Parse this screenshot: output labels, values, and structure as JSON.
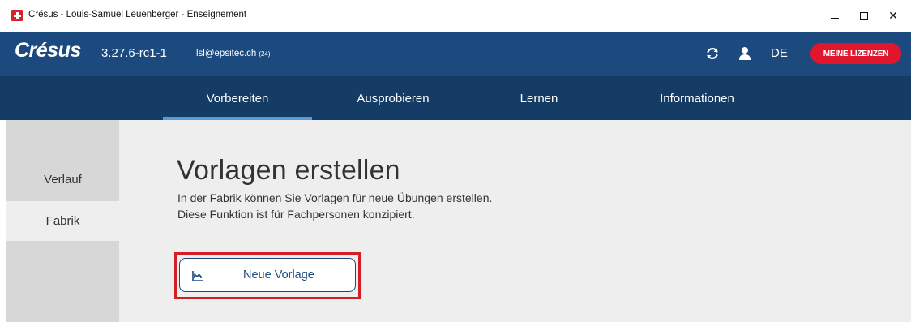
{
  "window": {
    "title": "Crésus - Louis-Samuel Leuenberger - Enseignement",
    "minimize_glyph": "—",
    "close_glyph": "✕"
  },
  "header": {
    "logo": "Crésus",
    "version": "3.27.6-rc1-1",
    "email": "lsl@epsitec.ch",
    "email_count": "(24)",
    "language": "DE",
    "license_button": "MEINE LIZENZEN",
    "icons": [
      "refresh-icon",
      "user-icon"
    ],
    "accent_color": "#1c4a7e",
    "license_color": "#e0172c"
  },
  "nav": {
    "items": [
      {
        "label": "Vorbereiten",
        "active": true
      },
      {
        "label": "Ausprobieren",
        "active": false
      },
      {
        "label": "Lernen",
        "active": false
      },
      {
        "label": "Informationen",
        "active": false
      }
    ]
  },
  "sidebar": {
    "items": [
      {
        "label": "Verlauf",
        "active": false
      },
      {
        "label": "Fabrik",
        "active": true
      }
    ]
  },
  "main": {
    "title": "Vorlagen erstellen",
    "description_line1": "In der Fabrik können Sie Vorlagen für neue Übungen erstellen.",
    "description_line2": "Diese Funktion ist für Fachpersonen konzipiert.",
    "new_template_button": "Neue Vorlage",
    "new_template_icon": "chart-icon",
    "highlight_color": "#d21f26"
  }
}
